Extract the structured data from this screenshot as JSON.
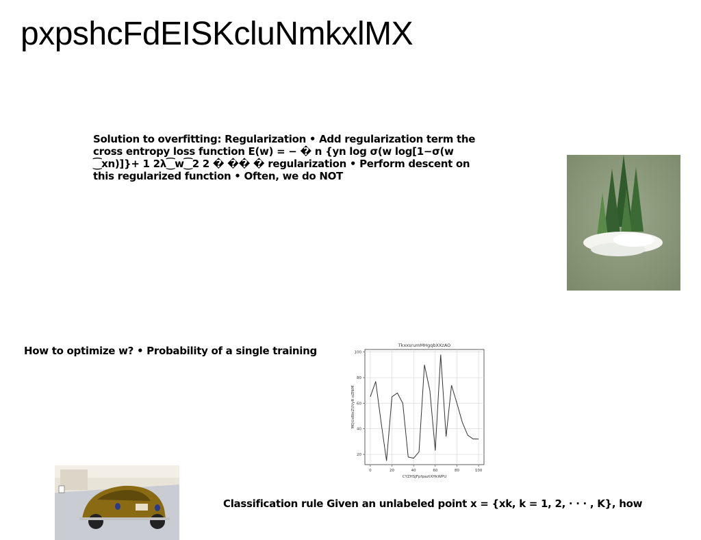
{
  "page": {
    "title": "pxpshcFdEISKcluNmkxlMX",
    "paragraphs": {
      "regularization": "Solution to overfitting: Regularization • Add regularization term the cross entropy loss function E(w) = − � n {yn log σ(w log[1−σ(w ⁐xn)]}+ 1 2λ⁐w⁐2 2 � �� � regularization • Perform descent on this regularized function • Often, we do NOT",
      "optimize": "How to optimize w? • Probability of a single training",
      "classification": "Classification rule Given an unlabeled point x = {xk, k = 1, 2, · · · , K}, how"
    }
  },
  "chart_data": {
    "type": "line",
    "title": "TkxxsrumMHgqbXXzAO",
    "xlabel": "CYZHSJFpfpaztXHkWPU",
    "ylabel": "MQUxBbiZUVyR oZNiM",
    "xlim": [
      -5,
      105
    ],
    "ylim": [
      12,
      102
    ],
    "xticks": [
      0,
      20,
      40,
      60,
      80,
      100
    ],
    "yticks": [
      20,
      40,
      60,
      80,
      100
    ],
    "grid": true,
    "series": [
      {
        "color": "#333333",
        "x": [
          0,
          5,
          10,
          15,
          20,
          25,
          30,
          35,
          40,
          45,
          50,
          55,
          60,
          65,
          70,
          75,
          80,
          85,
          90,
          95,
          100
        ],
        "y": [
          65,
          77,
          45,
          15,
          65,
          68,
          60,
          18,
          17,
          22,
          90,
          70,
          23,
          98,
          34,
          74,
          60,
          45,
          35,
          32,
          32
        ]
      }
    ]
  }
}
